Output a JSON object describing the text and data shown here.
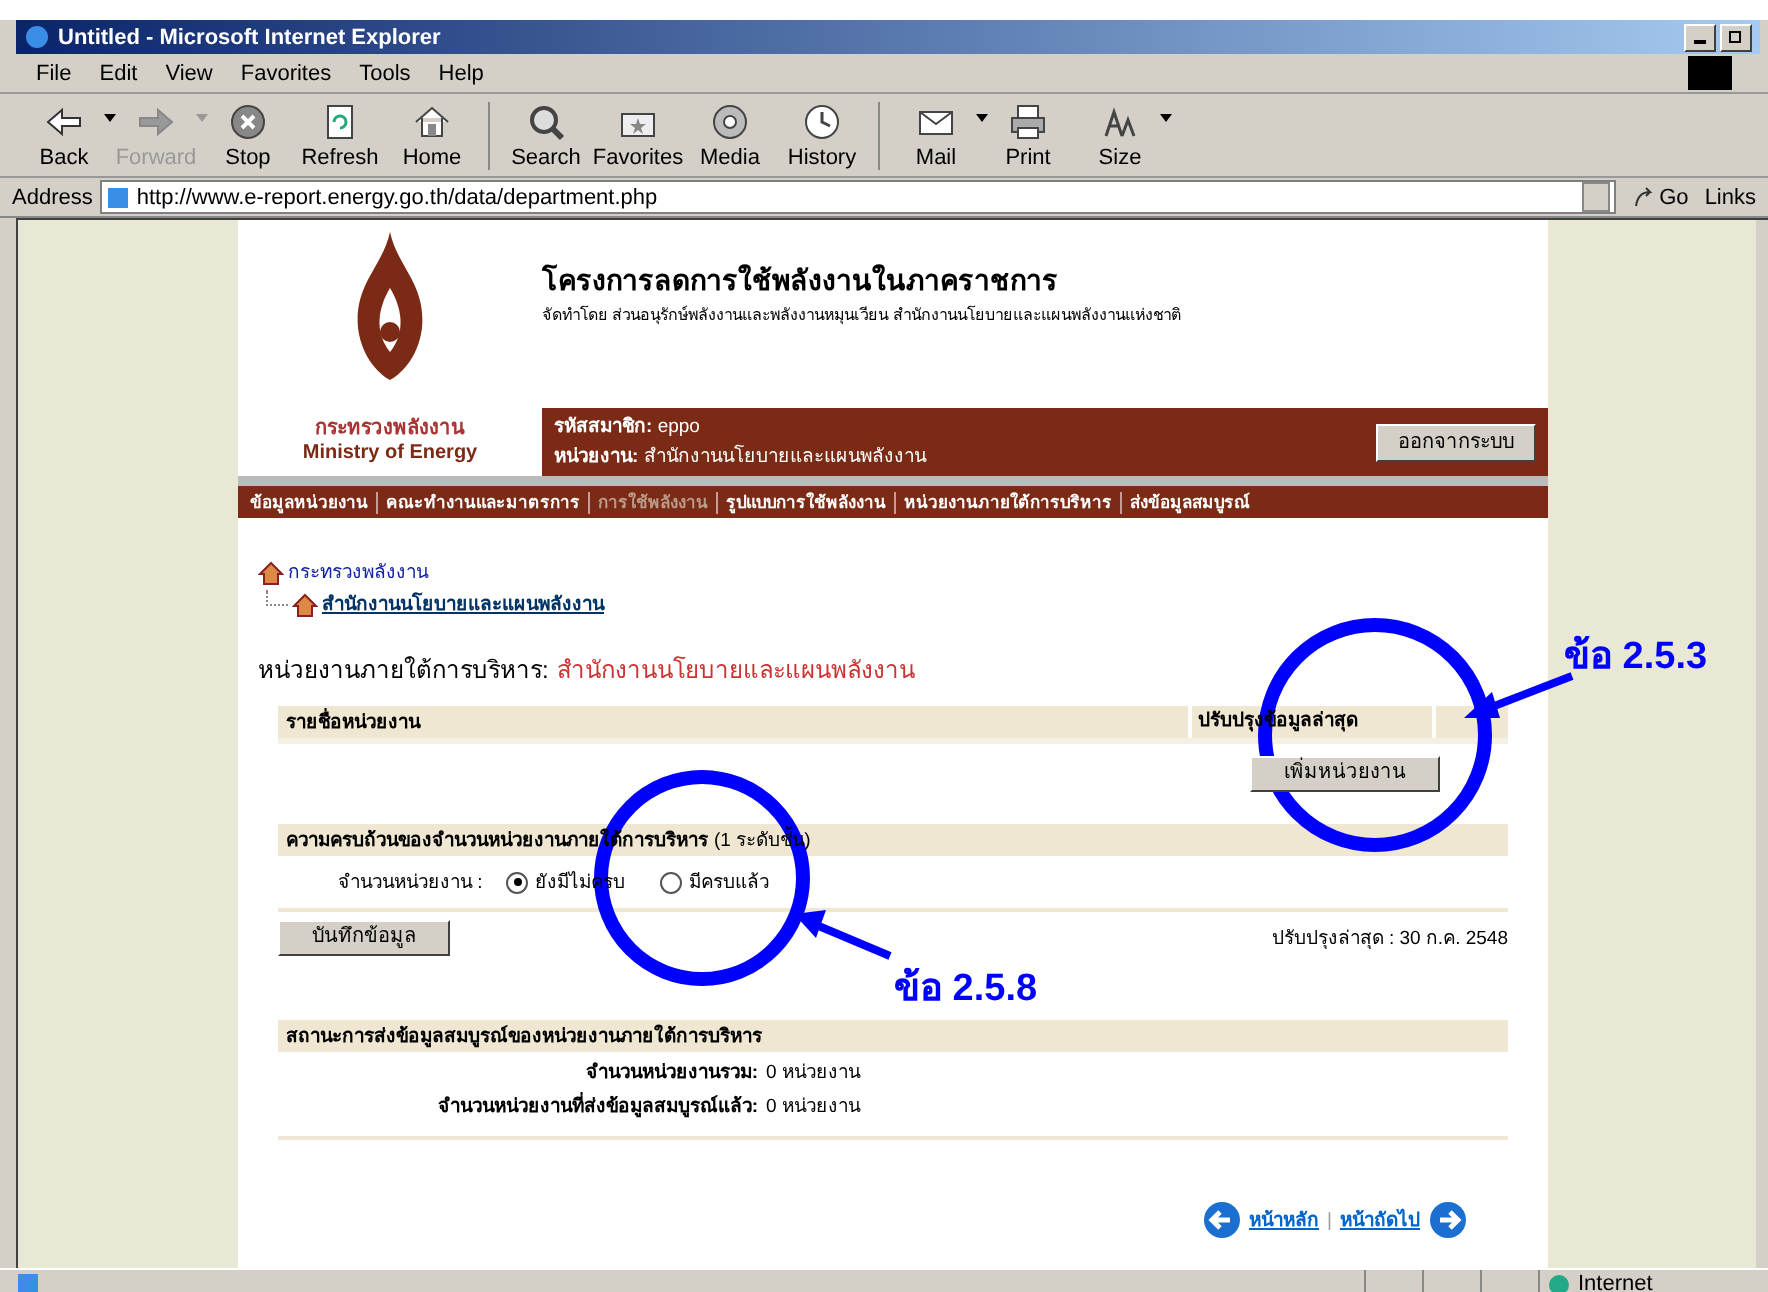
{
  "window": {
    "title": "Untitled - Microsoft Internet Explorer"
  },
  "menu": [
    "File",
    "Edit",
    "View",
    "Favorites",
    "Tools",
    "Help"
  ],
  "toolbar": [
    {
      "kind": "back",
      "label": "Back",
      "disabled": false,
      "dropdown": true
    },
    {
      "kind": "forward",
      "label": "Forward",
      "disabled": true,
      "dropdown": true
    },
    {
      "kind": "stop",
      "label": "Stop",
      "disabled": false,
      "dropdown": false
    },
    {
      "kind": "refresh",
      "label": "Refresh",
      "disabled": false,
      "dropdown": false
    },
    {
      "kind": "home",
      "label": "Home",
      "disabled": false,
      "dropdown": false
    },
    {
      "kind": "search",
      "label": "Search",
      "disabled": false,
      "dropdown": false
    },
    {
      "kind": "favorites",
      "label": "Favorites",
      "disabled": false,
      "dropdown": false
    },
    {
      "kind": "media",
      "label": "Media",
      "disabled": false,
      "dropdown": false
    },
    {
      "kind": "history",
      "label": "History",
      "disabled": false,
      "dropdown": false
    },
    {
      "kind": "mail",
      "label": "Mail",
      "disabled": false,
      "dropdown": true
    },
    {
      "kind": "print",
      "label": "Print",
      "disabled": false,
      "dropdown": false
    },
    {
      "kind": "size",
      "label": "Size",
      "disabled": false,
      "dropdown": true
    }
  ],
  "address": {
    "label": "Address",
    "value": "http://www.e-report.energy.go.th/data/department.php",
    "go": "Go",
    "links": "Links"
  },
  "page": {
    "logo_th": "กระทรวงพลังงาน",
    "logo_en": "Ministry of Energy",
    "site_title": "โครงการลดการใช้พลังงานในภาคราชการ",
    "subtitle": "จัดทำโดย ส่วนอนุรักษ์พลังงานและพลังงานหมุนเวียน สำนักงานนโยบายและแผนพลังงานแห่งชาติ",
    "member": {
      "label": "รหัสสมาชิก:",
      "value": "eppo"
    },
    "unit": {
      "label": "หน่วยงาน:",
      "value": "สำนักงานนโยบายและแผนพลังงาน"
    },
    "logout_button": "ออกจากระบบ",
    "nav": [
      {
        "label": "ข้อมูลหน่วยงาน",
        "disabled": false
      },
      {
        "label": "คณะทำงานและมาตรการ",
        "disabled": false
      },
      {
        "label": "การใช้พลังงาน",
        "disabled": true
      },
      {
        "label": "รูปแบบการใช้พลังงาน",
        "disabled": false
      },
      {
        "label": "หน่วยงานภายใต้การบริหาร",
        "disabled": false
      },
      {
        "label": "ส่งข้อมูลสมบูรณ์",
        "disabled": false
      }
    ],
    "breadcrumb": [
      {
        "label": "กระทรวงพลังงาน",
        "children": [
          {
            "label": "สำนักงานนโยบายและแผนพลังงาน"
          }
        ]
      }
    ],
    "heading": {
      "label": "หน่วยงานภายใต้การบริหาร:",
      "value": "สำนักงานนโยบายและแผนพลังงาน"
    },
    "units_table": {
      "columns": [
        "รายชื่อหน่วยงาน",
        "ปรับปรุงข้อมูลล่าสุด"
      ],
      "add_button": "เพิ่มหน่วยงาน"
    },
    "completeness": {
      "title": "ความครบถ้วนของจำนวนหน่วยงานภายใต้การบริหาร",
      "note": "(1 ระดับชั้น)",
      "field_label": "จำนวนหน่วยงาน :",
      "options": [
        {
          "label": "ยังมีไม่ครบ",
          "selected": true
        },
        {
          "label": "มีครบแล้ว",
          "selected": false
        }
      ],
      "save_button": "บันทึกข้อมูล",
      "updated": "ปรับปรุงล่าสุด : 30 ก.ค. 2548"
    },
    "status_section": {
      "title": "สถานะการส่งข้อมูลสมบูรณ์ของหน่วยงานภายใต้การบริหาร",
      "rows": [
        {
          "label": "จำนวนหน่วยงานรวม:",
          "value": "0 หน่วยงาน"
        },
        {
          "label": "จำนวนหน่วยงานที่ส่งข้อมูลสมบูรณ์แล้ว:",
          "value": "0 หน่วยงาน"
        }
      ]
    },
    "footer_links": [
      "หน้าหลัก",
      "|",
      "หน้าถัดไป"
    ]
  },
  "annotations": [
    "ข้อ 2.5.3",
    "ข้อ 2.5.8"
  ],
  "status_bar": {
    "zone": "Internet"
  }
}
